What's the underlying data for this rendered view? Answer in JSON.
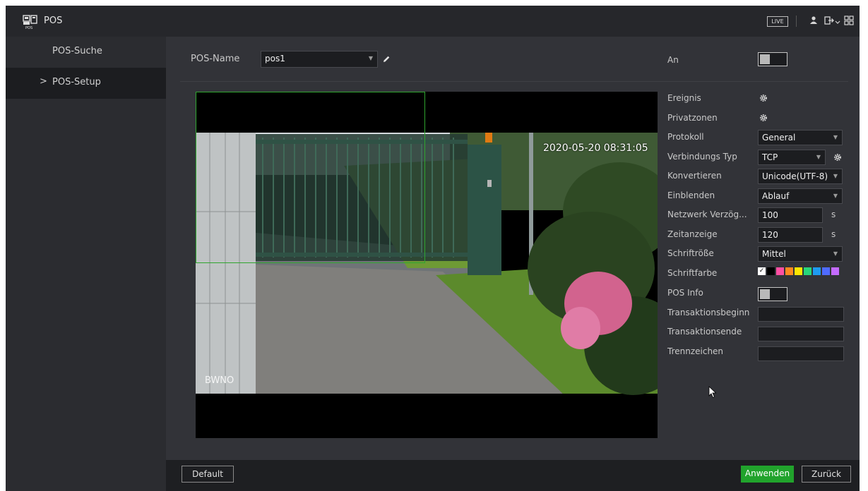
{
  "app": {
    "title": "POS",
    "logo_icon": "pos-terminal-icon",
    "live_badge": "LIVE"
  },
  "top_icons": [
    "user-icon",
    "logout-icon",
    "grid-menu-icon"
  ],
  "sidebar": {
    "items": [
      {
        "label": "POS-Suche",
        "active": false
      },
      {
        "label": "POS-Setup",
        "active": true,
        "chevron": ">"
      }
    ]
  },
  "form": {
    "pos_name_label": "POS-Name",
    "pos_name_value": "pos1",
    "an_label": "An",
    "an_enabled": false
  },
  "preview": {
    "timestamp": "2020-05-20 08:31:05",
    "channel_label": "BWNO"
  },
  "settings": {
    "ereignis_label": "Ereignis",
    "privatzonen_label": "Privatzonen",
    "protokoll_label": "Protokoll",
    "protokoll_value": "General",
    "verbindung_label": "Verbindungs Typ",
    "verbindung_value": "TCP",
    "konvertieren_label": "Konvertieren",
    "konvertieren_value": "Unicode(UTF-8)",
    "einblenden_label": "Einblenden",
    "einblenden_value": "Ablauf",
    "netzwerk_label": "Netzwerk Verzög...",
    "netzwerk_value": "100",
    "netzwerk_unit": "s",
    "zeitanzeige_label": "Zeitanzeige",
    "zeitanzeige_value": "120",
    "zeitanzeige_unit": "s",
    "schriftgroesse_label": "Schriftröße",
    "schriftgroesse_value": "Mittel",
    "schriftfarbe_label": "Schriftfarbe",
    "schriftfarbe_colors": [
      "#ffffff",
      "#000000",
      "#ff4fa3",
      "#ff8a1f",
      "#ffe600",
      "#27d67a",
      "#1e9bf0",
      "#4f6bff",
      "#c46bff"
    ],
    "posinfo_label": "POS Info",
    "posinfo_enabled": false,
    "trans_begin_label": "Transaktionsbeginn",
    "trans_begin_value": "",
    "trans_end_label": "Transaktionsende",
    "trans_end_value": "",
    "trennzeichen_label": "Trennzeichen",
    "trennzeichen_value": ""
  },
  "footer": {
    "default_label": "Default",
    "apply_label": "Anwenden",
    "back_label": "Zurück"
  }
}
